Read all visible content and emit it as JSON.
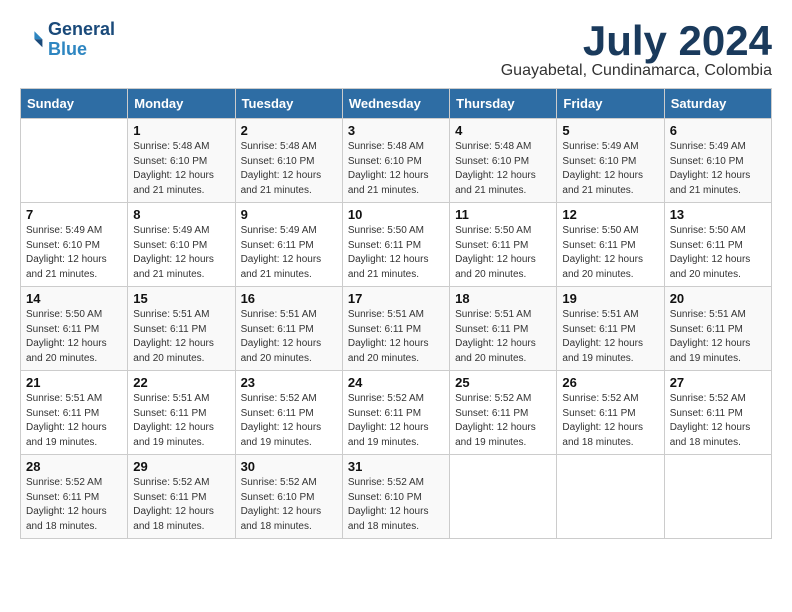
{
  "logo": {
    "line1": "General",
    "line2": "Blue"
  },
  "title": "July 2024",
  "location": "Guayabetal, Cundinamarca, Colombia",
  "days_of_week": [
    "Sunday",
    "Monday",
    "Tuesday",
    "Wednesday",
    "Thursday",
    "Friday",
    "Saturday"
  ],
  "weeks": [
    [
      {
        "num": "",
        "info": ""
      },
      {
        "num": "1",
        "info": "Sunrise: 5:48 AM\nSunset: 6:10 PM\nDaylight: 12 hours and 21 minutes."
      },
      {
        "num": "2",
        "info": "Sunrise: 5:48 AM\nSunset: 6:10 PM\nDaylight: 12 hours and 21 minutes."
      },
      {
        "num": "3",
        "info": "Sunrise: 5:48 AM\nSunset: 6:10 PM\nDaylight: 12 hours and 21 minutes."
      },
      {
        "num": "4",
        "info": "Sunrise: 5:48 AM\nSunset: 6:10 PM\nDaylight: 12 hours and 21 minutes."
      },
      {
        "num": "5",
        "info": "Sunrise: 5:49 AM\nSunset: 6:10 PM\nDaylight: 12 hours and 21 minutes."
      },
      {
        "num": "6",
        "info": "Sunrise: 5:49 AM\nSunset: 6:10 PM\nDaylight: 12 hours and 21 minutes."
      }
    ],
    [
      {
        "num": "7",
        "info": "Sunrise: 5:49 AM\nSunset: 6:10 PM\nDaylight: 12 hours and 21 minutes."
      },
      {
        "num": "8",
        "info": "Sunrise: 5:49 AM\nSunset: 6:10 PM\nDaylight: 12 hours and 21 minutes."
      },
      {
        "num": "9",
        "info": "Sunrise: 5:49 AM\nSunset: 6:11 PM\nDaylight: 12 hours and 21 minutes."
      },
      {
        "num": "10",
        "info": "Sunrise: 5:50 AM\nSunset: 6:11 PM\nDaylight: 12 hours and 21 minutes."
      },
      {
        "num": "11",
        "info": "Sunrise: 5:50 AM\nSunset: 6:11 PM\nDaylight: 12 hours and 20 minutes."
      },
      {
        "num": "12",
        "info": "Sunrise: 5:50 AM\nSunset: 6:11 PM\nDaylight: 12 hours and 20 minutes."
      },
      {
        "num": "13",
        "info": "Sunrise: 5:50 AM\nSunset: 6:11 PM\nDaylight: 12 hours and 20 minutes."
      }
    ],
    [
      {
        "num": "14",
        "info": "Sunrise: 5:50 AM\nSunset: 6:11 PM\nDaylight: 12 hours and 20 minutes."
      },
      {
        "num": "15",
        "info": "Sunrise: 5:51 AM\nSunset: 6:11 PM\nDaylight: 12 hours and 20 minutes."
      },
      {
        "num": "16",
        "info": "Sunrise: 5:51 AM\nSunset: 6:11 PM\nDaylight: 12 hours and 20 minutes."
      },
      {
        "num": "17",
        "info": "Sunrise: 5:51 AM\nSunset: 6:11 PM\nDaylight: 12 hours and 20 minutes."
      },
      {
        "num": "18",
        "info": "Sunrise: 5:51 AM\nSunset: 6:11 PM\nDaylight: 12 hours and 20 minutes."
      },
      {
        "num": "19",
        "info": "Sunrise: 5:51 AM\nSunset: 6:11 PM\nDaylight: 12 hours and 19 minutes."
      },
      {
        "num": "20",
        "info": "Sunrise: 5:51 AM\nSunset: 6:11 PM\nDaylight: 12 hours and 19 minutes."
      }
    ],
    [
      {
        "num": "21",
        "info": "Sunrise: 5:51 AM\nSunset: 6:11 PM\nDaylight: 12 hours and 19 minutes."
      },
      {
        "num": "22",
        "info": "Sunrise: 5:51 AM\nSunset: 6:11 PM\nDaylight: 12 hours and 19 minutes."
      },
      {
        "num": "23",
        "info": "Sunrise: 5:52 AM\nSunset: 6:11 PM\nDaylight: 12 hours and 19 minutes."
      },
      {
        "num": "24",
        "info": "Sunrise: 5:52 AM\nSunset: 6:11 PM\nDaylight: 12 hours and 19 minutes."
      },
      {
        "num": "25",
        "info": "Sunrise: 5:52 AM\nSunset: 6:11 PM\nDaylight: 12 hours and 19 minutes."
      },
      {
        "num": "26",
        "info": "Sunrise: 5:52 AM\nSunset: 6:11 PM\nDaylight: 12 hours and 18 minutes."
      },
      {
        "num": "27",
        "info": "Sunrise: 5:52 AM\nSunset: 6:11 PM\nDaylight: 12 hours and 18 minutes."
      }
    ],
    [
      {
        "num": "28",
        "info": "Sunrise: 5:52 AM\nSunset: 6:11 PM\nDaylight: 12 hours and 18 minutes."
      },
      {
        "num": "29",
        "info": "Sunrise: 5:52 AM\nSunset: 6:11 PM\nDaylight: 12 hours and 18 minutes."
      },
      {
        "num": "30",
        "info": "Sunrise: 5:52 AM\nSunset: 6:10 PM\nDaylight: 12 hours and 18 minutes."
      },
      {
        "num": "31",
        "info": "Sunrise: 5:52 AM\nSunset: 6:10 PM\nDaylight: 12 hours and 18 minutes."
      },
      {
        "num": "",
        "info": ""
      },
      {
        "num": "",
        "info": ""
      },
      {
        "num": "",
        "info": ""
      }
    ]
  ]
}
